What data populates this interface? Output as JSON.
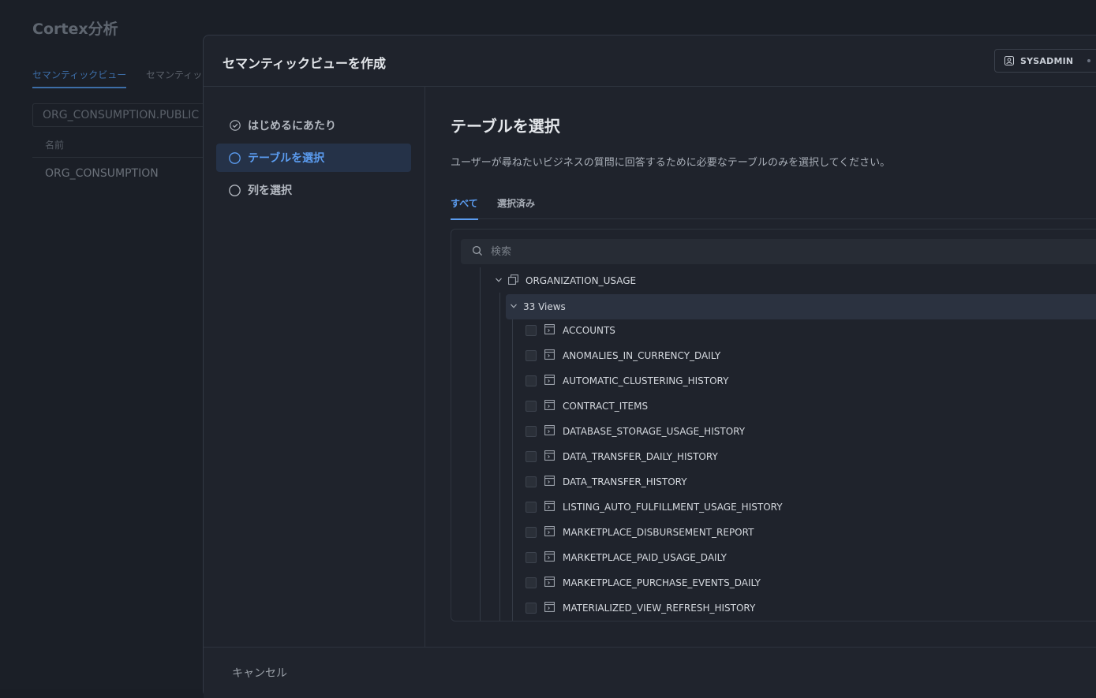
{
  "background": {
    "title": "Cortex分析",
    "tabs": [
      "セマンティックビュー",
      "セマンティッ"
    ],
    "field_value": "ORG_CONSUMPTION.PUBLIC",
    "column_header": "名前",
    "row": "ORG_CONSUMPTION"
  },
  "modal": {
    "title": "セマンティックビューを作成",
    "role": "SYSADMIN",
    "steps": [
      {
        "label": "はじめるにあたり",
        "status": "completed"
      },
      {
        "label": "テーブルを選択",
        "status": "active"
      },
      {
        "label": "列を選択",
        "status": "pending"
      }
    ],
    "section_title": "テーブルを選択",
    "description": "ユーザーが尋ねたいビジネスの質問に回答するために必要なテーブルのみを選択してください。",
    "tabs": [
      "すべて",
      "選択済み"
    ],
    "search_placeholder": "検索",
    "schema": "ORGANIZATION_USAGE",
    "group": "33 Views",
    "views": [
      "ACCOUNTS",
      "ANOMALIES_IN_CURRENCY_DAILY",
      "AUTOMATIC_CLUSTERING_HISTORY",
      "CONTRACT_ITEMS",
      "DATABASE_STORAGE_USAGE_HISTORY",
      "DATA_TRANSFER_DAILY_HISTORY",
      "DATA_TRANSFER_HISTORY",
      "LISTING_AUTO_FULFILLMENT_USAGE_HISTORY",
      "MARKETPLACE_DISBURSEMENT_REPORT",
      "MARKETPLACE_PAID_USAGE_DAILY",
      "MARKETPLACE_PURCHASE_EVENTS_DAILY",
      "MATERIALIZED_VIEW_REFRESH_HISTORY"
    ],
    "cancel": "キャンセル"
  },
  "colors": {
    "accent": "#5b9cf0",
    "background": "#1a1e26",
    "modal": "#1f232c"
  }
}
